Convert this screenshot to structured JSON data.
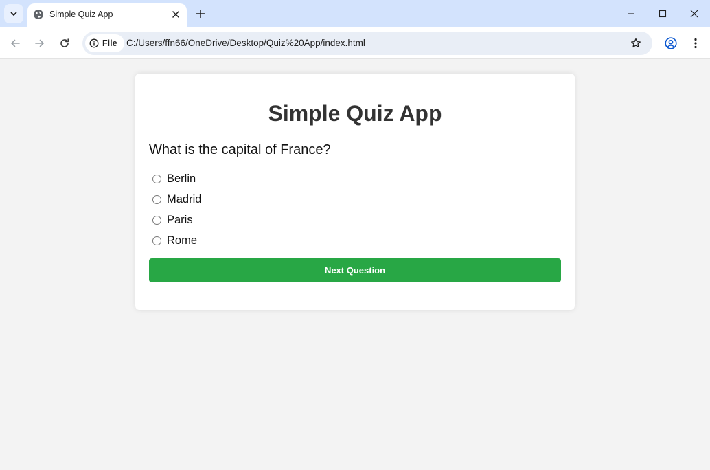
{
  "browser": {
    "tab": {
      "title": "Simple Quiz App",
      "favicon": "globe-icon"
    },
    "address_bar": {
      "chip_label": "File",
      "url": "C:/Users/ffn66/OneDrive/Desktop/Quiz%20App/index.html"
    },
    "icons": {
      "tab_search": "chevron-down-icon",
      "tab_close": "close-icon",
      "new_tab": "plus-icon",
      "back": "arrow-left-icon",
      "forward": "arrow-right-icon",
      "reload": "reload-icon",
      "site_info": "info-icon",
      "bookmark": "star-icon",
      "profile": "profile-icon",
      "menu": "kebab-menu-icon",
      "minimize": "minimize-icon",
      "maximize": "maximize-icon",
      "close_window": "close-icon"
    }
  },
  "quiz": {
    "title": "Simple Quiz App",
    "question": "What is the capital of France?",
    "options": [
      {
        "label": "Berlin",
        "selected": false
      },
      {
        "label": "Madrid",
        "selected": false
      },
      {
        "label": "Paris",
        "selected": false
      },
      {
        "label": "Rome",
        "selected": false
      }
    ],
    "next_button_label": "Next Question"
  },
  "colors": {
    "tabstrip": "#d3e3fd",
    "page_background": "#f3f3f3",
    "card_background": "#ffffff",
    "title_text": "#333333",
    "button_green": "#28a745",
    "button_text": "#ffffff"
  }
}
